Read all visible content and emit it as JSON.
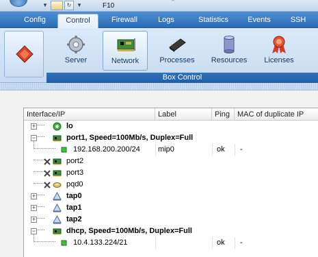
{
  "window": {
    "title": "F10"
  },
  "tabs": [
    {
      "label": "Config",
      "active": false
    },
    {
      "label": "Control",
      "active": true
    },
    {
      "label": "Firewall",
      "active": false
    },
    {
      "label": "Logs",
      "active": false
    },
    {
      "label": "Statistics",
      "active": false
    },
    {
      "label": "Events",
      "active": false
    },
    {
      "label": "SSH",
      "active": false
    }
  ],
  "ribbon": {
    "buttons": [
      {
        "label": "Server",
        "icon": "gear-icon",
        "active": false
      },
      {
        "label": "Network",
        "icon": "network-card-icon",
        "active": true
      },
      {
        "label": "Processes",
        "icon": "chip-icon",
        "active": false
      },
      {
        "label": "Resources",
        "icon": "database-icon",
        "active": false
      },
      {
        "label": "Licenses",
        "icon": "license-ribbon-icon",
        "active": false
      }
    ],
    "group_label": "Box Control"
  },
  "grid": {
    "columns": [
      "Interface/IP",
      "Label",
      "Ping",
      "MAC of duplicate IP"
    ],
    "rows": [
      {
        "name": "lo",
        "label": "",
        "ping": "",
        "mac": "",
        "icon": "loopback-icon",
        "expander": "+",
        "bold": true,
        "level": 0
      },
      {
        "name": "port1, Speed=100Mb/s, Duplex=Full",
        "label": "",
        "ping": "",
        "mac": "",
        "icon": "nic-icon",
        "expander": "-",
        "bold": true,
        "level": 0
      },
      {
        "name": "192.168.200.200/24",
        "label": "mip0",
        "ping": "ok",
        "mac": "-",
        "icon": "ip-status-icon",
        "expander": "",
        "bold": false,
        "level": 1
      },
      {
        "name": "port2",
        "label": "",
        "ping": "",
        "mac": "",
        "icon": "nic-disabled-icon",
        "expander": "",
        "bold": false,
        "level": 0
      },
      {
        "name": "port3",
        "label": "",
        "ping": "",
        "mac": "",
        "icon": "nic-disabled-icon",
        "expander": "",
        "bold": false,
        "level": 0
      },
      {
        "name": "pqd0",
        "label": "",
        "ping": "",
        "mac": "",
        "icon": "pqd-disabled-icon",
        "expander": "",
        "bold": false,
        "level": 0
      },
      {
        "name": "tap0",
        "label": "",
        "ping": "",
        "mac": "",
        "icon": "tap-icon",
        "expander": "+",
        "bold": true,
        "level": 0
      },
      {
        "name": "tap1",
        "label": "",
        "ping": "",
        "mac": "",
        "icon": "tap-icon",
        "expander": "+",
        "bold": true,
        "level": 0
      },
      {
        "name": "tap2",
        "label": "",
        "ping": "",
        "mac": "",
        "icon": "tap-icon",
        "expander": "+",
        "bold": true,
        "level": 0
      },
      {
        "name": "dhcp, Speed=100Mb/s, Duplex=Full",
        "label": "",
        "ping": "",
        "mac": "",
        "icon": "nic-icon",
        "expander": "-",
        "bold": true,
        "level": 0
      },
      {
        "name": "10.4.133.224/21",
        "label": "",
        "ping": "ok",
        "mac": "-",
        "icon": "ip-status-icon",
        "expander": "",
        "bold": false,
        "level": 1
      }
    ]
  }
}
